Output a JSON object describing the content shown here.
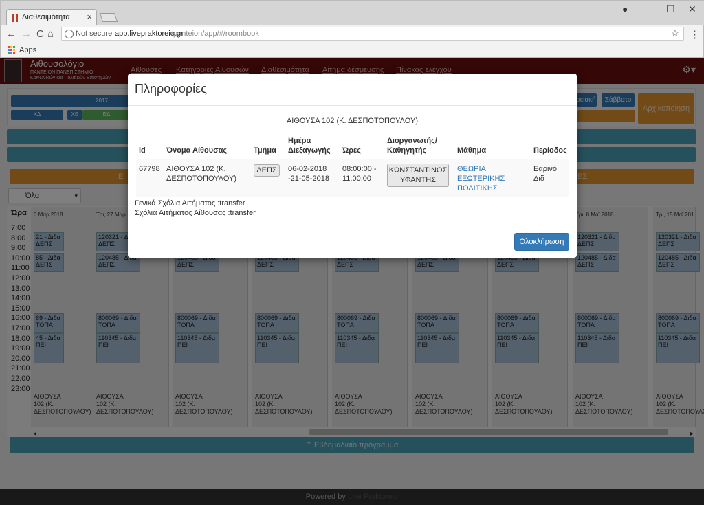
{
  "browser": {
    "tab_title": "Διαθεσιμότητα",
    "tab_close": "×",
    "url_info": "i",
    "not_secure": "Not secure",
    "url_host": "app.livepraktoreio.gr",
    "url_path": "/panteion/app/#/roombook",
    "bookmark_apps": "Apps",
    "back": "←",
    "forward": "→",
    "reload": "C",
    "home": "⌂",
    "star": "☆",
    "menu": "⋮",
    "profile": "●",
    "minimize": "—",
    "maximize": "☐",
    "close": "✕"
  },
  "app": {
    "brand_title": "Αιθουσολόγιο",
    "brand_sub1": "ΠΑΝΤΕΙΟΝ ΠΑΝΕΠΙΣΤΗΜΙΟ",
    "brand_sub2": "Κοινωνικών και Πολιτικών Επιστημών",
    "nav": [
      "Αίθουσες",
      "Κατηγορίες Αιθουσών",
      "Διαθεσιμότητα",
      "Αίτημα δέσμευσης",
      "Πίνακας ελέγχου"
    ],
    "gear": "⚙▾",
    "year_btn": "2017",
    "day_btns": [
      "ΧΔ",
      "ΧΕ",
      "ΕΔ"
    ],
    "btn_kyriaki_partial": "ρειακή",
    "btn_saturday": "Σάββατο",
    "btn_reset": "Αρχικοποίηση",
    "filter_select": "Όλα",
    "filter_arrow": "▾",
    "hours_header": "Ώρα",
    "hours": [
      "7:00",
      "8:00",
      "9:00",
      "10:00",
      "11:00",
      "12:00",
      "13:00",
      "14:00",
      "15:00",
      "16:00",
      "17:00",
      "18:00",
      "19:00",
      "20:00",
      "21:00",
      "22:00",
      "23:00"
    ],
    "day_headers": [
      "0 Μαρ 2018",
      "Τρι, 27 Μαρ",
      "",
      "",
      "",
      "",
      "",
      "Τρι, 8 Μαΐ 2018",
      "Τρι, 15 Μαΐ 201"
    ],
    "booking_labels": {
      "b1_code": "120321 - Διδα",
      "b1_dept": "ΔΕΠΣ",
      "b2_code": "120485 - Διδα",
      "b2_dept": "ΔΕΠΣ",
      "b3_code": "800069 - Διδα",
      "b3_dept": "ΤΟΠΑ",
      "b4_code": "110345 - Διδα",
      "b4_dept": "ΠΕΙ",
      "b1_code_partial": "21 - Διδα",
      "b2_code_partial": "85 - Διδα",
      "b3_code_partial": "69 - Διδα",
      "b4_code_partial": "45 - Διδα"
    },
    "room_label_full": "ΑΙΘΟΥΣΑ\n102 (Κ.\nΔΕΣΠΟΤΟΠΟΥΛΟΥ)",
    "room_label_partial_1": "ΟΥΣΑ",
    "room_label_partial_2": "Κ.",
    "room_label_partial_3": "ΣΠΟΤΟΠΟΥΛΟΥ)",
    "weekly_program": "⌃ Εβδομαδιαίο πρόγραμμα",
    "footer_powered": "Powered by",
    "footer_brand": "Live Praktoreio",
    "scroll_left": "◂",
    "scroll_right": "▸",
    "partial_letter_E": "Ε",
    "partial_letter_S": "ΕΣ"
  },
  "modal": {
    "title": "Πληροφορίες",
    "room_heading": "ΑΙΘΟΥΣΑ 102 (Κ. ΔΕΣΠΟΤΟΠΟΥΛΟΥ)",
    "columns": {
      "id": "id",
      "room": "Όνομα Αίθουσας",
      "dept": "Τμήμα",
      "date_l1": "Ημέρα",
      "date_l2": "Διεξαγωγής",
      "hours": "Ώρες",
      "organizer_l1": "Διοργανωτής/",
      "organizer_l2": "Καθηγητής",
      "course": "Μάθημα",
      "period": "Περίοδος"
    },
    "row": {
      "id": "67798",
      "room_l1": "ΑΙΘΟΥΣΑ 102 (Κ.",
      "room_l2": "ΔΕΣΠΟΤΟΠΟΥΛΟΥ)",
      "dept": "ΔΕΠΣ",
      "date_l1": "06-02-2018",
      "date_l2": "-21-05-2018",
      "hours_l1": "08:00:00 -",
      "hours_l2": "11:00:00",
      "organizer_l1": "ΚΩΝΣΤΑΝΤΙΝΟΣ",
      "organizer_l2": "ΥΦΑΝΤΗΣ",
      "course_l1": "ΘΕΩΡΙΑ",
      "course_l2": "ΕΞΩΤΕΡΙΚΗΣ",
      "course_l3": "ΠΟΛΙΤΙΚΗΣ",
      "period_l1": "Εαρινό",
      "period_l2": "Διδ"
    },
    "note_general": "Γενικά Σχόλια Αιτήματος :transfer",
    "note_room": "Σχόλια Αιτήματος Αίθουσας :transfer",
    "complete_button": "Ολοκλήρωση"
  },
  "colors": {
    "nav_bg": "#6b0f0f",
    "primary": "#337ab7",
    "teal": "#4ba3b8",
    "orange": "#e2952f",
    "green": "#5cb85c"
  }
}
